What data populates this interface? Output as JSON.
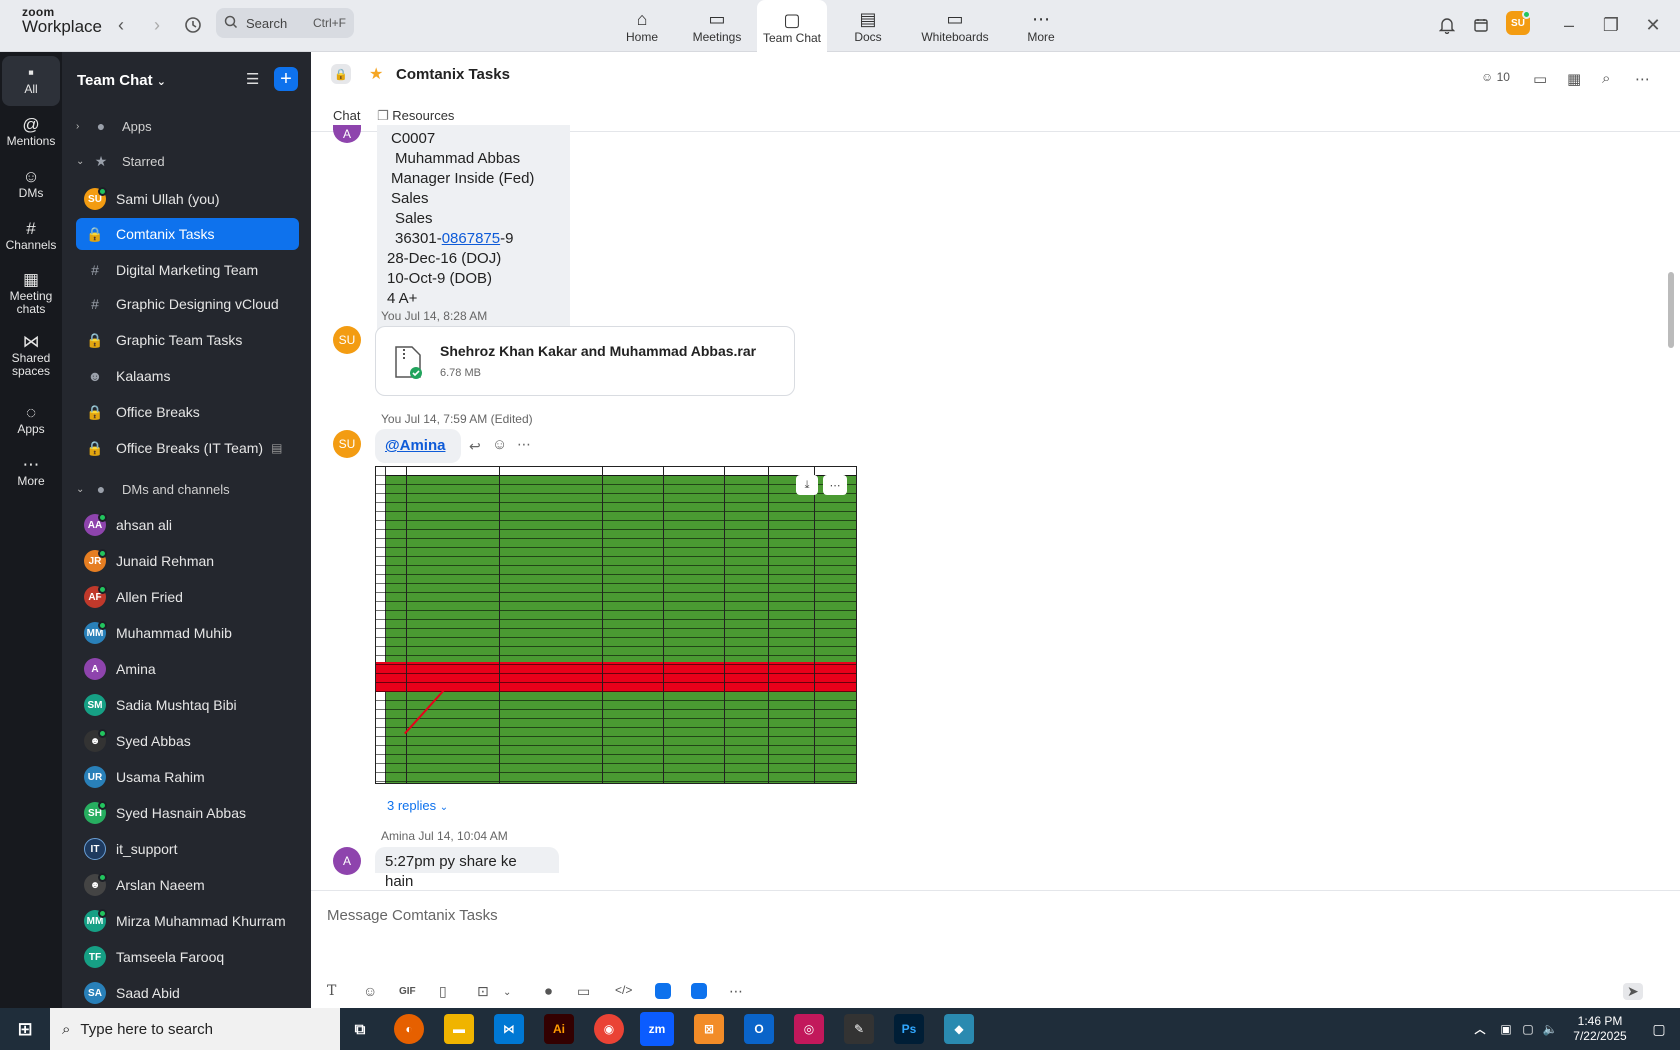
{
  "app": {
    "brand_top": "zoom",
    "brand_bottom": "Workplace"
  },
  "search": {
    "label": "Search",
    "shortcut": "Ctrl+F"
  },
  "nav": [
    {
      "label": "Home",
      "icon": "home-icon"
    },
    {
      "label": "Meetings",
      "icon": "video-icon"
    },
    {
      "label": "Team Chat",
      "icon": "chat-icon"
    },
    {
      "label": "Docs",
      "icon": "doc-icon"
    },
    {
      "label": "Whiteboards",
      "icon": "whiteboard-icon"
    },
    {
      "label": "More",
      "icon": "more-icon"
    }
  ],
  "user_initials": "SU",
  "rail": [
    {
      "label": "All"
    },
    {
      "label": "Mentions"
    },
    {
      "label": "DMs"
    },
    {
      "label": "Channels"
    },
    {
      "label": "Meeting chats"
    },
    {
      "label": "Shared spaces"
    },
    {
      "label": "Apps"
    },
    {
      "label": "More"
    }
  ],
  "sidebar": {
    "title": "Team Chat",
    "sections": {
      "apps": "Apps",
      "starred": "Starred",
      "dms": "DMs and channels"
    },
    "starred": [
      {
        "label": "Sami Ullah (you)",
        "initials": "SU",
        "color": "#f39c12"
      },
      {
        "label": "Comtanix Tasks",
        "icon": "lock-icon"
      },
      {
        "label": "Digital Marketing Team",
        "icon": "hash-icon"
      },
      {
        "label": "Graphic Designing vCloud",
        "icon": "hash-icon"
      },
      {
        "label": "Graphic Team Tasks",
        "icon": "lock-icon"
      },
      {
        "label": "Kalaams",
        "icon": "people-icon"
      },
      {
        "label": "Office Breaks",
        "icon": "lock-icon"
      },
      {
        "label": "Office Breaks (IT Team)",
        "icon": "lock-icon"
      }
    ],
    "dms": [
      {
        "label": "ahsan ali",
        "initials": "AA",
        "color": "#8e44ad"
      },
      {
        "label": "Junaid Rehman",
        "initials": "JR",
        "color": "#e67e22"
      },
      {
        "label": "Allen Fried",
        "initials": "AF",
        "color": "#c0392b"
      },
      {
        "label": "Muhammad Muhib",
        "initials": "MM",
        "color": "#2980b9"
      },
      {
        "label": "Amina",
        "initials": "A",
        "color": "#8e44ad"
      },
      {
        "label": "Sadia Mushtaq Bibi",
        "initials": "SM",
        "color": "#16a085"
      },
      {
        "label": "Syed Abbas",
        "initials": "",
        "color": "#333"
      },
      {
        "label": "Usama Rahim",
        "initials": "UR",
        "color": "#2980b9"
      },
      {
        "label": "Syed Hasnain Abbas",
        "initials": "SH",
        "color": "#27ae60"
      },
      {
        "label": "it_support",
        "initials": "IT",
        "color": "#1e3a5f"
      },
      {
        "label": "Arslan Naeem",
        "initials": "",
        "color": "#444"
      },
      {
        "label": "Mirza Muhammad Khurram",
        "initials": "MM",
        "color": "#16a085"
      },
      {
        "label": "Tamseela Farooq",
        "initials": "TF",
        "color": "#16a085"
      },
      {
        "label": "Saad Abid",
        "initials": "SA",
        "color": "#2980b9"
      }
    ]
  },
  "channel": {
    "name": "Comtanix Tasks",
    "tabs": [
      "Chat",
      "Resources"
    ],
    "members": "10"
  },
  "messages": {
    "m1_lines": [
      "C0007",
      "Muhammad Abbas",
      "Manager Inside (Fed) Sales",
      "Sales",
      "36301-",
      "0867875",
      "-9",
      "28-Dec-16 (DOJ)",
      "10-Oct-9 (DOB)",
      "4 A+"
    ],
    "m2_meta": "You Jul 14, 8:28 AM",
    "file_name": "Shehroz Khan Kakar and Muhammad Abbas.rar",
    "file_size": "6.78 MB",
    "m3_meta": "You Jul 14, 7:59 AM (Edited)",
    "mention": "@Amina",
    "replies": "3 replies",
    "m4_meta": "Amina Jul 14, 10:04 AM",
    "m4_text": "5:27pm py share ke hain",
    "avatar_a": "A",
    "avatar_su": "SU"
  },
  "composer": {
    "placeholder": "Message Comtanix Tasks",
    "gif": "GIF"
  },
  "taskbar": {
    "search": "Type here to search",
    "time": "1:46 PM",
    "date": "7/22/2025"
  }
}
